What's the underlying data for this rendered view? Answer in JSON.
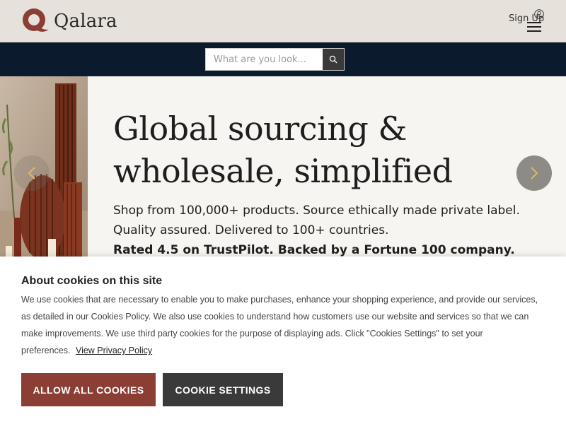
{
  "header": {
    "brand": "Qalara",
    "brand_color": "#8b3e33",
    "signup_label": "Sign Up",
    "user_icon": "user-icon",
    "menu_icon": "hamburger-menu-icon"
  },
  "search": {
    "placeholder": "What are you look...",
    "button_icon": "search-icon"
  },
  "hero": {
    "title_line1": "Global sourcing &",
    "title_line2": "wholesale, simplified",
    "subtitle_line1": "Shop from 100,000+ products. Source ethically made private label.",
    "subtitle_line2": "Quality assured. Delivered to 100+ countries.",
    "rated": "Rated 4.5 on TrustPilot. Backed by a Fortune 100 company.",
    "prev_icon": "chevron-left-icon",
    "next_icon": "chevron-right-icon"
  },
  "cookie_banner": {
    "title": "About cookies on this site",
    "line1": "We use cookies that are necessary to enable you to make purchases, enhance your shopping experience, and provide our services,",
    "line2": "as detailed in our Cookies Policy. We also use cookies to understand how customers use our website and services so that we can",
    "line3": "make improvements. We use third party cookies for the purpose of displaying ads. Click \"Cookies Settings\" to set your",
    "line4": "preferences.",
    "privacy_link": "View Privacy Policy",
    "allow_label": "ALLOW ALL COOKIES",
    "settings_label": "COOKIE SETTINGS",
    "allow_color": "#8b3e33",
    "settings_color": "#3a3a3a"
  }
}
